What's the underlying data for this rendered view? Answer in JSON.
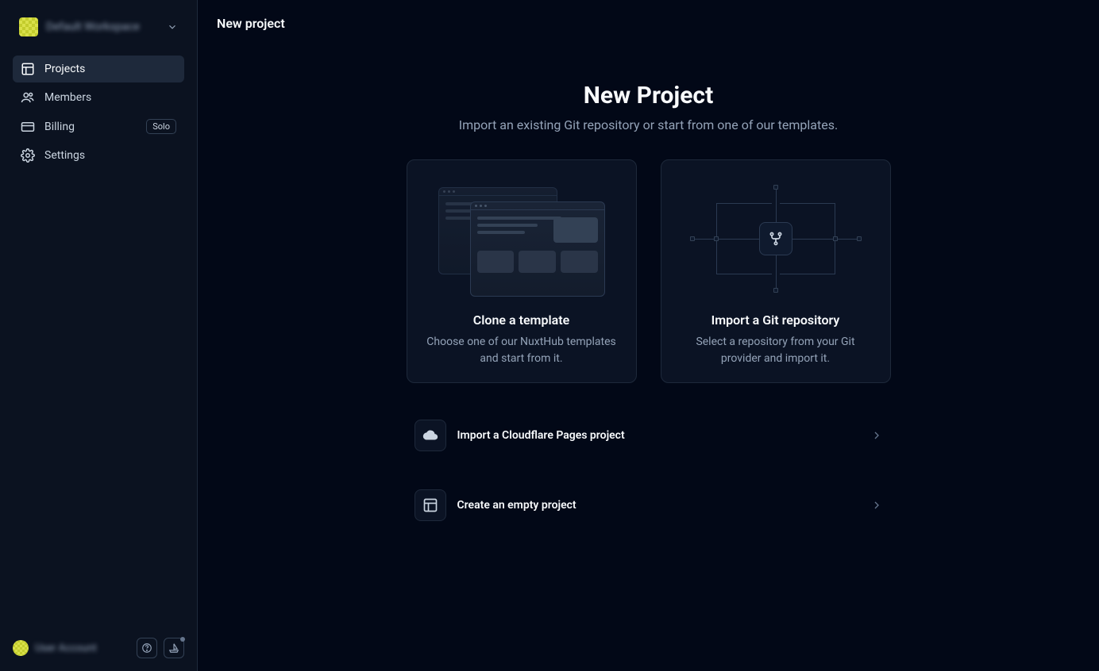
{
  "workspace": {
    "name": "Default Workspace"
  },
  "sidebar": {
    "items": [
      {
        "label": "Projects",
        "icon": "layout-icon",
        "active": true
      },
      {
        "label": "Members",
        "icon": "users-icon"
      },
      {
        "label": "Billing",
        "icon": "card-icon",
        "badge": "Solo"
      },
      {
        "label": "Settings",
        "icon": "gear-icon"
      }
    ]
  },
  "footer": {
    "user_name": "User Account"
  },
  "page": {
    "breadcrumb": "New project",
    "hero_title": "New Project",
    "hero_subtitle": "Import an existing Git repository or start from one of our templates."
  },
  "cards": {
    "template": {
      "title": "Clone a template",
      "desc": "Choose one of our NuxtHub templates and start from it."
    },
    "git": {
      "title": "Import a Git repository",
      "desc": "Select a repository from your Git provider and import it."
    }
  },
  "options": {
    "cloudflare": "Import a Cloudflare Pages project",
    "empty": "Create an empty project"
  }
}
